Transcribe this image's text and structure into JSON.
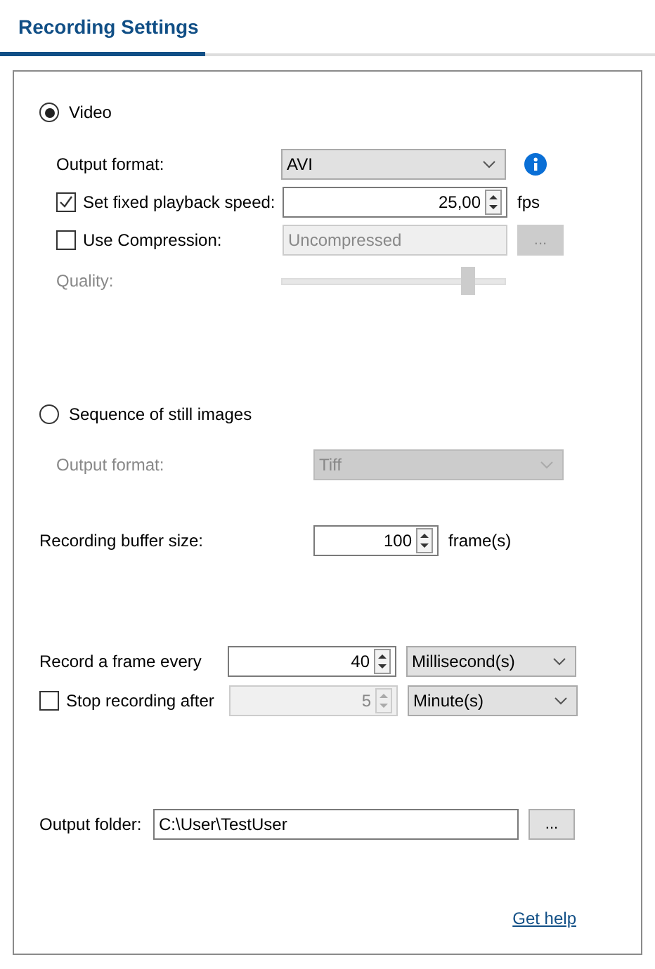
{
  "tab": {
    "label": "Recording Settings",
    "selected": true
  },
  "video": {
    "label": "Video",
    "selected": true,
    "output_format": {
      "label": "Output format:",
      "value": "AVI"
    },
    "playback": {
      "label": "Set fixed playback speed:",
      "checked": true,
      "value": "25,00",
      "unit": "fps"
    },
    "compression": {
      "label": "Use Compression:",
      "checked": false,
      "value": "Uncompressed",
      "button": "..."
    },
    "quality": {
      "label": "Quality:",
      "level": 0.83
    }
  },
  "sequence": {
    "label": "Sequence of still images",
    "selected": false,
    "output_format": {
      "label": "Output format:",
      "value": "Tiff"
    }
  },
  "buffer": {
    "label": "Recording buffer size:",
    "value": "100",
    "unit": "frame(s)"
  },
  "record_every": {
    "label": "Record a frame every",
    "value": "40",
    "unit": "Millisecond(s)"
  },
  "stop_after": {
    "label": "Stop recording after",
    "checked": false,
    "value": "5",
    "unit": "Minute(s)"
  },
  "output_folder": {
    "label": "Output folder:",
    "value": "C:\\User\\TestUser",
    "button": "..."
  },
  "help_link": "Get help"
}
